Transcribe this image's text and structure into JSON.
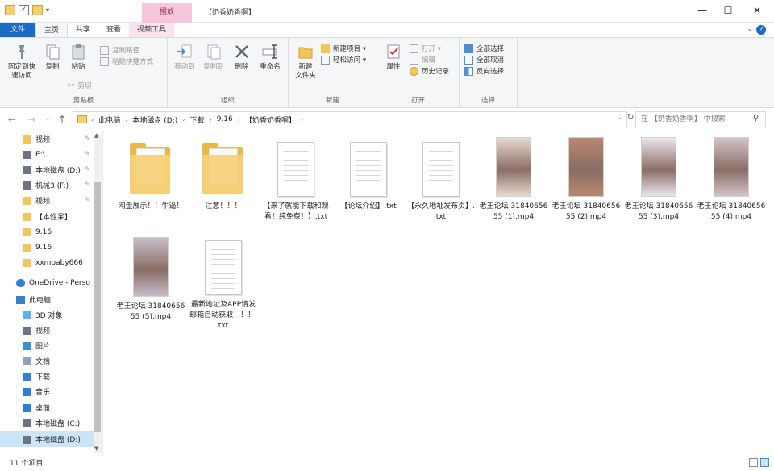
{
  "window": {
    "title": "【奶香奶香啊】",
    "context_tab": "播放",
    "controls": {
      "minimize": "—",
      "maximize": "☐",
      "close": "✕"
    }
  },
  "tabs": {
    "file": "文件",
    "home": "主页",
    "share": "共享",
    "view": "查看",
    "video_tools": "视频工具"
  },
  "ribbon": {
    "clipboard": {
      "name": "剪贴板",
      "pin": "固定到快\n速访问",
      "copy": "复制",
      "paste": "粘贴",
      "copy_path": "复制路径",
      "paste_shortcut": "粘贴快捷方式",
      "cut": "剪切"
    },
    "organize": {
      "name": "组织",
      "move_to": "移动到",
      "copy_to": "复制到",
      "delete": "删除",
      "rename": "重命名"
    },
    "new": {
      "name": "新建",
      "new_folder": "新建\n文件夹",
      "new_item": "新建项目 ▾",
      "easy_access": "轻松访问 ▾"
    },
    "open": {
      "name": "打开",
      "properties": "属性",
      "open": "打开 ▾",
      "edit": "编辑",
      "history": "历史记录"
    },
    "select": {
      "name": "选择",
      "select_all": "全部选择",
      "select_none": "全部取消",
      "invert": "反向选择"
    }
  },
  "address": {
    "crumbs": [
      "此电脑",
      "本地磁盘 (D:)",
      "下载",
      "9.16",
      "【奶香奶香啊】"
    ],
    "search_placeholder": "在 【奶香奶香啊】 中搜索"
  },
  "nav": [
    {
      "label": "视频",
      "icon": "folder-icon",
      "pinned": true
    },
    {
      "label": "E:\\",
      "icon": "drive-icon",
      "pinned": true
    },
    {
      "label": "本地磁盘 (D:)",
      "icon": "drive-icon",
      "pinned": true
    },
    {
      "label": "机械3 (F:)",
      "icon": "drive-icon",
      "pinned": true
    },
    {
      "label": "视频",
      "icon": "folder-icon",
      "pinned": true
    },
    {
      "label": "【本性呆】",
      "icon": "folder-icon",
      "pinned": false
    },
    {
      "label": "9.16",
      "icon": "folder-icon",
      "pinned": false
    },
    {
      "label": "9.16",
      "icon": "folder-icon",
      "pinned": false
    },
    {
      "label": "xxmbaby666",
      "icon": "folder-icon",
      "pinned": false
    },
    {
      "label": "OneDrive - Perso",
      "icon": "cloud-icon",
      "pinned": false
    },
    {
      "label": "此电脑",
      "icon": "pc-icon",
      "pinned": false
    },
    {
      "label": "3D 对象",
      "icon": "cube-icon",
      "pinned": false
    },
    {
      "label": "视频",
      "icon": "video-icon",
      "pinned": false
    },
    {
      "label": "图片",
      "icon": "picture-icon",
      "pinned": false
    },
    {
      "label": "文档",
      "icon": "document-icon",
      "pinned": false
    },
    {
      "label": "下载",
      "icon": "download-icon",
      "pinned": false
    },
    {
      "label": "音乐",
      "icon": "music-icon",
      "pinned": false
    },
    {
      "label": "桌面",
      "icon": "desktop-icon",
      "pinned": false
    },
    {
      "label": "本地磁盘 (C:)",
      "icon": "drive-icon",
      "pinned": false
    },
    {
      "label": "本地磁盘 (D:)",
      "icon": "drive-icon",
      "pinned": false
    }
  ],
  "files": [
    {
      "name": "网盘展示！！牛逼！",
      "type": "folder"
    },
    {
      "name": "注意！！！",
      "type": "folder"
    },
    {
      "name": "【来了就能下载和观看！纯免费！】.txt",
      "type": "txt"
    },
    {
      "name": "【论坛介绍】.txt",
      "type": "txt"
    },
    {
      "name": "【永久地址发布页】.txt",
      "type": "txt"
    },
    {
      "name": "老王论坛 3184065655 (1).mp4",
      "type": "video",
      "color": "#e8d9cf"
    },
    {
      "name": "老王论坛 3184065655 (2).mp4",
      "type": "video",
      "color": "#b8876e"
    },
    {
      "name": "老王论坛 3184065655 (3).mp4",
      "type": "video",
      "color": "#ece5ec"
    },
    {
      "name": "老王论坛 3184065655 (4).mp4",
      "type": "video",
      "color": "#d3c3c8"
    },
    {
      "name": "老王论坛 3184065655 (5).mp4",
      "type": "video",
      "color": "#c6bcc9"
    },
    {
      "name": "最新地址及APP请发邮箱自动获取！！！.txt",
      "type": "txt"
    }
  ],
  "status": {
    "count": "11 个项目"
  },
  "colors": {
    "accent": "#1a6cc5",
    "context_tab": "#f6c7dc",
    "selection": "#cce4f7"
  }
}
